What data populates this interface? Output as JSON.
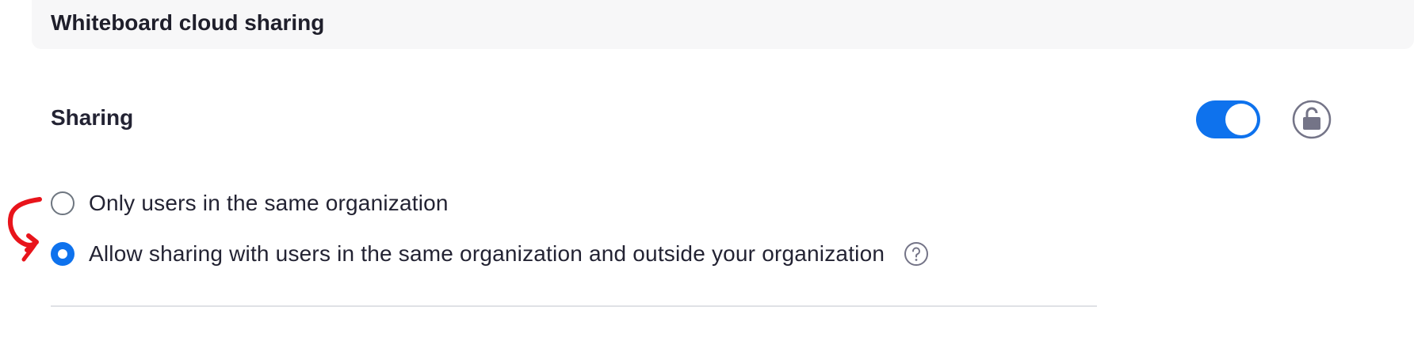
{
  "section": {
    "title": "Whiteboard cloud sharing"
  },
  "setting": {
    "label": "Sharing",
    "toggle_on": true,
    "locked": false
  },
  "options": [
    {
      "label": "Only users in the same organization",
      "selected": false
    },
    {
      "label": "Allow sharing with users in the same organization and outside your organization",
      "selected": true,
      "has_help": true
    }
  ],
  "icons": {
    "lock": "unlocked-padlock-icon",
    "help": "question-circle-icon",
    "annotation": "red-arrow-annotation"
  },
  "colors": {
    "accent": "#0e72ed",
    "header_bg": "#f7f7f8",
    "annotation": "#e8141b"
  }
}
